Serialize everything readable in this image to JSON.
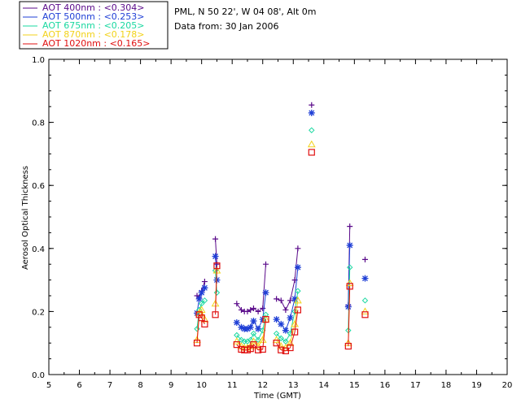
{
  "legend": {
    "entries": [
      {
        "text": "AOT  400nm : <0.304>",
        "color": "#5a0a8a"
      },
      {
        "text": "AOT  500nm : <0.253>",
        "color": "#1f3fd6"
      },
      {
        "text": "AOT  675nm : <0.205>",
        "color": "#19d8a0"
      },
      {
        "text": "AOT  870nm : <0.178>",
        "color": "#f2d21a"
      },
      {
        "text": "AOT 1020nm : <0.165>",
        "color": "#e01010"
      }
    ]
  },
  "info": {
    "location": "PML, N 50 22', W 04 08', Alt 0m",
    "date": "Data from: 30 Jan 2006"
  },
  "chart_data": {
    "type": "line",
    "xlabel": "Time (GMT)",
    "ylabel": "Aerosol Optical Thickness",
    "xlim": [
      5,
      20
    ],
    "ylim": [
      0.0,
      1.0
    ],
    "xticks": [
      "5",
      "6",
      "7",
      "8",
      "9",
      "10",
      "11",
      "12",
      "13",
      "14",
      "15",
      "16",
      "17",
      "18",
      "19",
      "20"
    ],
    "yticks": [
      "0.0",
      "0.2",
      "0.4",
      "0.6",
      "0.8",
      "1.0"
    ],
    "grid": false,
    "series": [
      {
        "name": "AOT  400nm : <0.304>",
        "color": "#5a0a8a",
        "marker": "plus",
        "segments": [
          [
            [
              9.85,
              0.25
            ],
            [
              9.92,
              0.245
            ],
            [
              10.0,
              0.265
            ],
            [
              10.1,
              0.295
            ]
          ],
          [
            [
              10.45,
              0.43
            ],
            [
              10.5,
              0.35
            ]
          ],
          [
            [
              11.15,
              0.225
            ],
            [
              11.3,
              0.205
            ],
            [
              11.4,
              0.2
            ],
            [
              11.5,
              0.2
            ],
            [
              11.6,
              0.205
            ],
            [
              11.7,
              0.21
            ],
            [
              11.85,
              0.2
            ],
            [
              12.0,
              0.21
            ],
            [
              12.1,
              0.35
            ]
          ],
          [
            [
              12.45,
              0.24
            ],
            [
              12.6,
              0.235
            ],
            [
              12.75,
              0.205
            ],
            [
              12.9,
              0.235
            ],
            [
              13.05,
              0.3
            ],
            [
              13.15,
              0.4
            ]
          ],
          [
            [
              13.6,
              0.855
            ]
          ],
          [
            [
              14.85,
              0.47
            ],
            [
              14.8,
              0.22
            ]
          ],
          [
            [
              15.35,
              0.365
            ]
          ]
        ]
      },
      {
        "name": "AOT  500nm : <0.253>",
        "color": "#1f3fd6",
        "marker": "star",
        "segments": [
          [
            [
              9.85,
              0.195
            ],
            [
              9.92,
              0.24
            ],
            [
              10.0,
              0.26
            ],
            [
              10.1,
              0.275
            ]
          ],
          [
            [
              10.45,
              0.375
            ],
            [
              10.5,
              0.3
            ]
          ],
          [
            [
              11.15,
              0.165
            ],
            [
              11.3,
              0.15
            ],
            [
              11.4,
              0.145
            ],
            [
              11.5,
              0.145
            ],
            [
              11.6,
              0.15
            ],
            [
              11.7,
              0.17
            ],
            [
              11.85,
              0.145
            ],
            [
              12.0,
              0.175
            ],
            [
              12.1,
              0.26
            ]
          ],
          [
            [
              12.45,
              0.175
            ],
            [
              12.6,
              0.16
            ],
            [
              12.75,
              0.14
            ],
            [
              12.9,
              0.18
            ],
            [
              13.05,
              0.24
            ],
            [
              13.15,
              0.34
            ]
          ],
          [
            [
              13.6,
              0.83
            ]
          ],
          [
            [
              14.85,
              0.41
            ],
            [
              14.8,
              0.215
            ]
          ],
          [
            [
              15.35,
              0.305
            ]
          ]
        ]
      },
      {
        "name": "AOT  675nm : <0.205>",
        "color": "#19d8a0",
        "marker": "diamond",
        "segments": [
          [
            [
              9.85,
              0.145
            ],
            [
              9.92,
              0.205
            ],
            [
              10.0,
              0.225
            ],
            [
              10.1,
              0.235
            ]
          ],
          [
            [
              10.45,
              0.33
            ],
            [
              10.5,
              0.26
            ]
          ],
          [
            [
              11.15,
              0.125
            ],
            [
              11.3,
              0.11
            ],
            [
              11.4,
              0.105
            ],
            [
              11.5,
              0.105
            ],
            [
              11.6,
              0.11
            ],
            [
              11.7,
              0.13
            ],
            [
              11.85,
              0.11
            ],
            [
              12.0,
              0.14
            ],
            [
              12.1,
              0.19
            ]
          ],
          [
            [
              12.45,
              0.13
            ],
            [
              12.6,
              0.115
            ],
            [
              12.75,
              0.105
            ],
            [
              12.9,
              0.13
            ],
            [
              13.05,
              0.2
            ],
            [
              13.15,
              0.265
            ]
          ],
          [
            [
              13.6,
              0.775
            ]
          ],
          [
            [
              14.85,
              0.34
            ],
            [
              14.8,
              0.14
            ]
          ],
          [
            [
              15.35,
              0.235
            ]
          ]
        ]
      },
      {
        "name": "AOT  870nm : <0.178>",
        "color": "#f2d21a",
        "marker": "triangle",
        "segments": [
          [
            [
              9.85,
              0.11
            ],
            [
              9.92,
              0.195
            ],
            [
              10.0,
              0.205
            ],
            [
              10.1,
              0.175
            ]
          ],
          [
            [
              10.45,
              0.225
            ],
            [
              10.5,
              0.33
            ]
          ],
          [
            [
              11.15,
              0.105
            ],
            [
              11.3,
              0.09
            ],
            [
              11.4,
              0.085
            ],
            [
              11.5,
              0.085
            ],
            [
              11.6,
              0.09
            ],
            [
              11.7,
              0.105
            ],
            [
              11.85,
              0.09
            ],
            [
              12.0,
              0.11
            ],
            [
              12.1,
              0.175
            ]
          ],
          [
            [
              12.45,
              0.11
            ],
            [
              12.6,
              0.09
            ],
            [
              12.75,
              0.085
            ],
            [
              12.9,
              0.1
            ],
            [
              13.05,
              0.16
            ],
            [
              13.15,
              0.235
            ]
          ],
          [
            [
              13.6,
              0.73
            ]
          ],
          [
            [
              14.85,
              0.29
            ],
            [
              14.8,
              0.1
            ]
          ],
          [
            [
              15.35,
              0.2
            ]
          ]
        ]
      },
      {
        "name": "AOT 1020nm : <0.165>",
        "color": "#e01010",
        "marker": "square",
        "segments": [
          [
            [
              9.85,
              0.1
            ],
            [
              9.92,
              0.19
            ],
            [
              10.0,
              0.18
            ],
            [
              10.1,
              0.16
            ]
          ],
          [
            [
              10.45,
              0.19
            ],
            [
              10.5,
              0.345
            ]
          ],
          [
            [
              11.15,
              0.095
            ],
            [
              11.3,
              0.08
            ],
            [
              11.4,
              0.078
            ],
            [
              11.5,
              0.078
            ],
            [
              11.6,
              0.082
            ],
            [
              11.7,
              0.095
            ],
            [
              11.85,
              0.078
            ],
            [
              12.0,
              0.08
            ],
            [
              12.1,
              0.175
            ]
          ],
          [
            [
              12.45,
              0.1
            ],
            [
              12.6,
              0.078
            ],
            [
              12.75,
              0.075
            ],
            [
              12.9,
              0.085
            ],
            [
              13.05,
              0.135
            ],
            [
              13.15,
              0.205
            ]
          ],
          [
            [
              13.6,
              0.705
            ]
          ],
          [
            [
              14.85,
              0.28
            ],
            [
              14.8,
              0.09
            ]
          ],
          [
            [
              15.35,
              0.19
            ]
          ]
        ]
      }
    ]
  }
}
